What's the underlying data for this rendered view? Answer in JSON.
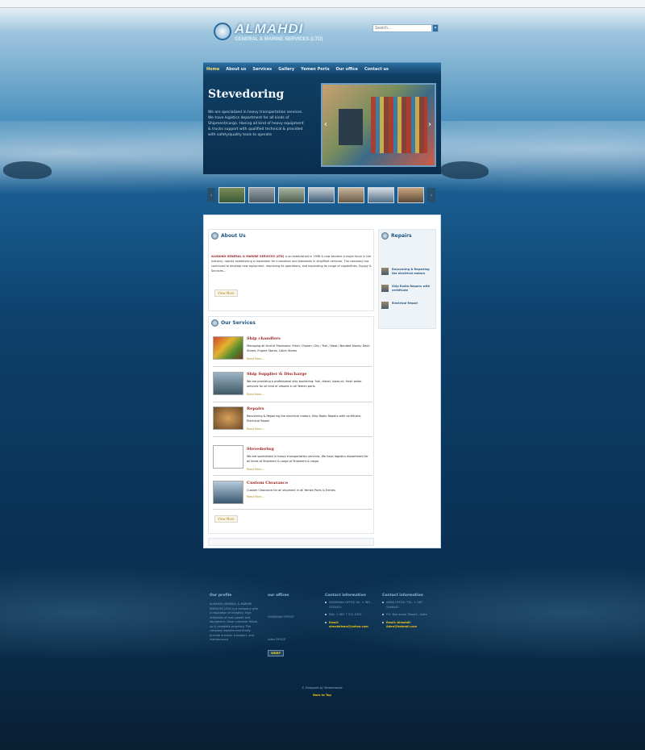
{
  "brand": {
    "name": "ALMAHDI",
    "subtitle": "GENERAL & MARINE SERVICES (LTD)"
  },
  "search": {
    "placeholder": "Search...",
    "button_label": "»"
  },
  "nav": {
    "items": [
      "Home",
      "About us",
      "Services",
      "Gallery",
      "Yemen Ports",
      "Our office",
      "Contact us"
    ],
    "active": "Home"
  },
  "hero": {
    "title": "Stevedoring",
    "text": "We are specialized in heavy transportation services. We have logistics department for all kinds of Shipment/cargo. Having all kind of heavy equipment & trucks support with qualified technical & provided with safety/quality tools to operate",
    "prev_label": "‹",
    "next_label": "›"
  },
  "thumbs": {
    "prev_label": "‹",
    "next_label": "›",
    "count_images": 7
  },
  "about": {
    "title": "About Us",
    "company": "ALMAHDI GENERAL & MARINE SERVICES (LTD)",
    "text": " is an established in 1998 & now became a major force in the industry, rapidly establishing a reputation for innovation and standards in ship/fleet services. The company has continued to develop new equipment, improving its operations, and expanding its range of capabilities, Supply & Services...",
    "view_more": "View More"
  },
  "services": {
    "title": "Our Services",
    "items": [
      {
        "title": "Ship chandlers",
        "desc": "Managing all kind of Provisions: Fresh / Frozen / Dry / Fish / Meat / Bonded Stores; Deck Stores; Engine Stores; Cabin Stores",
        "more": "Read More..."
      },
      {
        "title": "Ship Supplier & Discharge",
        "desc": "We are providing a professional ship bunkering: fuel, diesel, lubes oil, fresh water services for all kind of vessels in all Yemen ports",
        "more": "Read More..."
      },
      {
        "title": "Repairs",
        "desc": "Recovering & Repairing the electrical motors; Ship Radio Repairs with certificate; Electrical Repair",
        "more": "Read More..."
      },
      {
        "title": "Stevedoring",
        "desc": "We are specialized in heavy transportation services. We have logistics department for all kinds of Shipment & cargo of Shipment & cargo.",
        "more": "Read More..."
      },
      {
        "title": "Custom Clearance",
        "desc": "Custom Clearance for all shipment in all Yemen Ports & Entries",
        "more": "Read More..."
      }
    ],
    "view_more": "View More"
  },
  "repairs": {
    "title": "Repairs",
    "items": [
      "Recovering & Repairing the electrical motors",
      "Ship Radio Repairs with certificate",
      "Electrical Repair"
    ]
  },
  "footer": {
    "profile": {
      "title": "Our profile",
      "text": "ALMAHDI GENERAL & MARINE SERVICES (LTD) is a company with a reputation of integrity, high utilization of man power and equipment, close customer follow up & complete propriety. The company experienced timely provide armada, transport, and maintenance."
    },
    "offices": {
      "title": "our offices",
      "office1": "HODEIDAH OFFICE",
      "office2": "Aden OFFICE",
      "badge": "WDRP"
    },
    "contact1": {
      "title": "Contact information",
      "line1": "HODEIDAH OFFICE Tel. + 967 - 3250322",
      "line2": "FAX: + 967 7 511 0322",
      "email_label": "Email:",
      "email": "almahdisma@yahoo.com"
    },
    "contact2": {
      "title": "Contact information",
      "line1": "ADEN OFFICE: TEL: + 967 - 2246445",
      "line2": "P.O. Box xxxxx Tawahi - Aden",
      "email_label": "Email: Almahdi-",
      "email": "Aden@hotmail.com"
    },
    "credit": "© Designed by Tahamawave",
    "back_to_top": "Back to Top"
  }
}
